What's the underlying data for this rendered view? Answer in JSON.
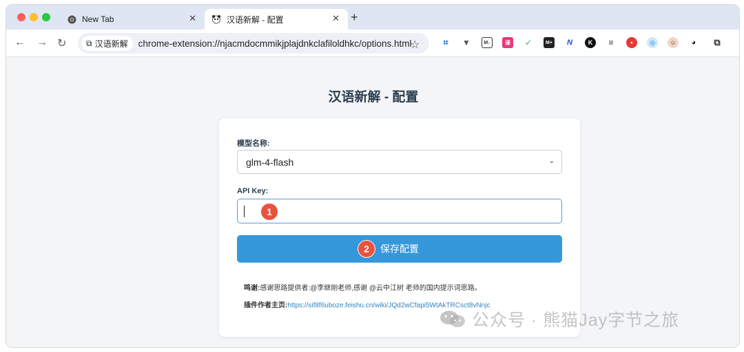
{
  "browser": {
    "tabs": [
      {
        "title": "New Tab",
        "icon": "chrome-icon"
      },
      {
        "title": "汉语新解 - 配置",
        "icon": "panda-icon",
        "active": true
      }
    ],
    "omnibox": {
      "chip_label": "汉语新解",
      "url": "chrome-extension://njacmdocmmikjplajdnkclafiloldhkc/options.html"
    }
  },
  "page": {
    "title": "汉语新解 - 配置",
    "model_label": "模型名称:",
    "model_value": "glm-4-flash",
    "api_key_label": "API Key:",
    "api_key_value": "",
    "save_label": "保存配置",
    "thanks_prefix": "鸣谢:",
    "thanks_text": "感谢思路提供者:@李继刚老师,感谢 @云中江树 老师的国内提示词思路。",
    "homepage_prefix": "插件作者主页:",
    "homepage_url": "https://sif8f6uboze.feishu.cn/wiki/JQd2wCfapi5WtAkTRCsct8vNnjc"
  },
  "annotations": {
    "badge1": "1",
    "badge2": "2"
  },
  "watermark": "公众号 · 熊猫Jay字节之旅",
  "colors": {
    "accent": "#3498db",
    "badge": "#e8533f",
    "title": "#2c3e50"
  }
}
